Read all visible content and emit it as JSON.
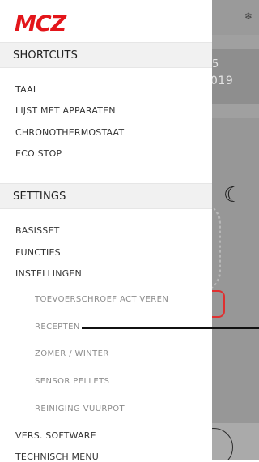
{
  "brand": {
    "logo_text": "MCZ",
    "logo_color": "#e3151a"
  },
  "background": {
    "snow_icon": "❄",
    "date_top": "5",
    "date": "019",
    "moon_icon": "☾"
  },
  "shortcuts": {
    "header": "SHORTCUTS",
    "items": [
      {
        "label": "TAAL"
      },
      {
        "label": "LIJST MET APPARATEN"
      },
      {
        "label": "CHRONOTHERMOSTAAT"
      },
      {
        "label": "ECO STOP"
      }
    ]
  },
  "settings": {
    "header": "SETTINGS",
    "items": [
      {
        "label": "BASISSET"
      },
      {
        "label": "FUNCTIES"
      },
      {
        "label": "INSTELLINGEN"
      }
    ],
    "sub_items": [
      {
        "label": "TOEVOERSCHROEF ACTIVEREN"
      },
      {
        "label": "RECEPTEN"
      },
      {
        "label": "ZOMER / WINTER"
      },
      {
        "label": "SENSOR PELLETS"
      },
      {
        "label": "REINIGING VUURPOT"
      }
    ],
    "more_items": [
      {
        "label": "VERS. SOFTWARE"
      },
      {
        "label": "TECHNISCH MENU"
      }
    ]
  }
}
